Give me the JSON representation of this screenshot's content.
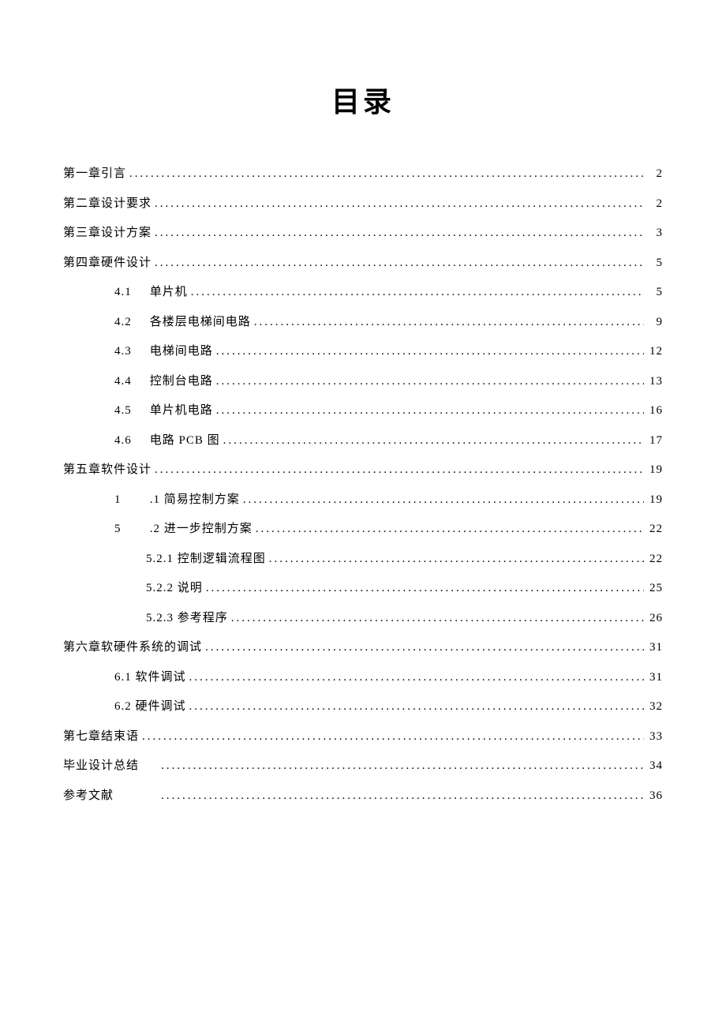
{
  "title": "目录",
  "entries": [
    {
      "level": 0,
      "num": "",
      "label": "第一章引言",
      "page": "2"
    },
    {
      "level": 0,
      "num": "",
      "label": "第二章设计要求",
      "page": "2"
    },
    {
      "level": 0,
      "num": "",
      "label": "第三章设计方案",
      "page": "3"
    },
    {
      "level": 0,
      "num": "",
      "label": "第四章硬件设计",
      "page": "5"
    },
    {
      "level": 1,
      "num": "4.1",
      "label": "单片机",
      "page": "5"
    },
    {
      "level": 1,
      "num": "4.2",
      "label": "各楼层电梯间电路",
      "page": "9"
    },
    {
      "level": 1,
      "num": "4.3",
      "label": "电梯间电路",
      "page": "12"
    },
    {
      "level": 1,
      "num": "4.4",
      "label": "控制台电路",
      "page": "13"
    },
    {
      "level": 1,
      "num": "4.5",
      "label": "单片机电路",
      "page": "16"
    },
    {
      "level": 1,
      "num": "4.6",
      "label": "电路 PCB 图",
      "page": "17"
    },
    {
      "level": 0,
      "num": "",
      "label": "第五章软件设计",
      "page": "19"
    },
    {
      "level": 1,
      "num": "1",
      "label": ".1 简易控制方案",
      "page": "19"
    },
    {
      "level": 1,
      "num": "5",
      "label": ".2 进一步控制方案",
      "page": "22"
    },
    {
      "level": 2,
      "num": "",
      "label": "5.2.1 控制逻辑流程图",
      "page": "22"
    },
    {
      "level": 2,
      "num": "",
      "label": "5.2.2 说明",
      "page": "25"
    },
    {
      "level": 2,
      "num": "",
      "label": "5.2.3 参考程序",
      "page": "26"
    },
    {
      "level": 0,
      "num": "",
      "label": "第六章软硬件系统的调试",
      "page": "31"
    },
    {
      "level": 1,
      "num": "",
      "label": "6.1 软件调试",
      "page": "31"
    },
    {
      "level": 1,
      "num": "",
      "label": "6.2 硬件调试",
      "page": "32"
    },
    {
      "level": 0,
      "num": "",
      "label": "第七章结束语",
      "page": "33"
    },
    {
      "level": 0,
      "num": "",
      "label": "毕业设计总结",
      "page": "34",
      "spaced": true
    },
    {
      "level": 0,
      "num": "",
      "label": "参考文献",
      "page": "36",
      "spaced": true
    }
  ]
}
